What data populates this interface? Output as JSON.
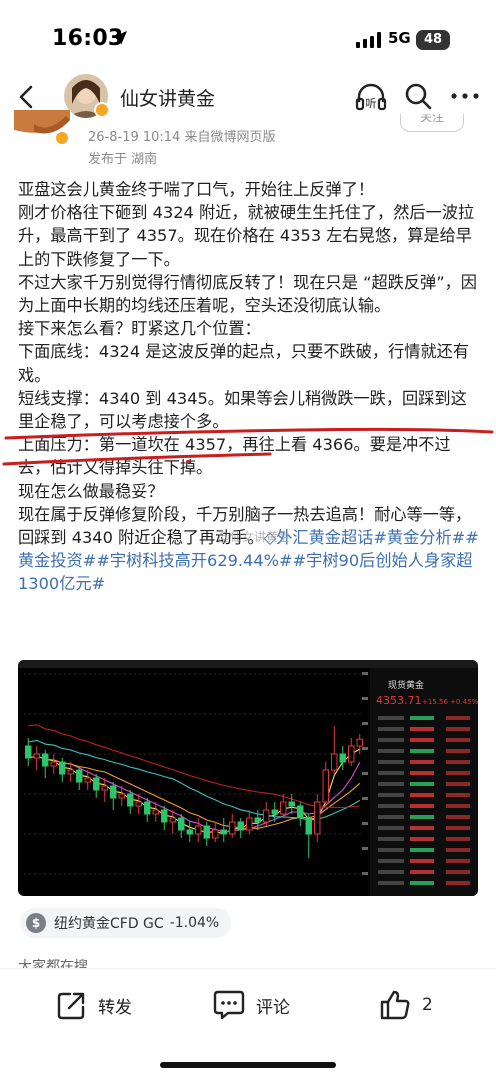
{
  "status_bar": {
    "time": "16:03",
    "network": "5G",
    "battery": "48"
  },
  "header": {
    "title": "仙女讲黄金",
    "back_icon": "chevron-left-icon",
    "listen_icon": "listen-icon",
    "listen_label": "听",
    "search_icon": "search-icon",
    "more_icon": "more-icon"
  },
  "post": {
    "date_source": "26-8-19 10:14  来自微博网页版",
    "location": "发布于 湖南",
    "follow_label": "关注",
    "paragraphs": [
      "亚盘这会儿黄金终于喘了口气，开始往上反弹了！",
      "刚才价格往下砸到 4324 附近，就被硬生生托住了，然后一波拉升，最高干到了 4357。现在价格在 4353 左右晃悠，算是给早上的下跌修复了一下。",
      "不过大家千万别觉得行情彻底反转了！现在只是 “超跌反弹”，因为上面中长期的均线还压着呢，空头还没彻底认输。",
      "接下来怎么看？盯紧这几个位置：",
      "下面底线：4324 是这波反弹的起点，只要不跌破，行情就还有戏。",
      "短线支撑：4340 到 4345。如果等会儿稍微跌一跌，回踩到这里企稳了，可以考虑接个多。",
      "上面压力：第一道坎在 4357，再往上看 4366。要是冲不过去，估计又得掉头往下掉。",
      "现在怎么做最稳妥？",
      "现在属于反弹修复阶段，千万别脑子一热去追高！耐心等一等，回踩到 4340 附近企稳了再动手。"
    ],
    "topics_link": "外汇黄金超话",
    "hashtags": [
      "#黄金分析#",
      "#黄金投资#",
      "#宇树科技高开629.44%#",
      "#宇树90后创始人身家超1300亿元#"
    ],
    "watermark": "@仙女讲黄金"
  },
  "chart_data": {
    "type": "candlestick",
    "title": "",
    "price_axis_range": [
      4320,
      4370
    ],
    "overlay_labels": [
      "现货黄金",
      "4353.71",
      "+15.56",
      "+0.45%"
    ],
    "candles": [
      {
        "o": 4352,
        "c": 4349,
        "h": 4354,
        "l": 4347
      },
      {
        "o": 4349,
        "c": 4350,
        "h": 4352,
        "l": 4346
      },
      {
        "o": 4350,
        "c": 4347,
        "h": 4351,
        "l": 4344
      },
      {
        "o": 4347,
        "c": 4348,
        "h": 4350,
        "l": 4345
      },
      {
        "o": 4348,
        "c": 4345,
        "h": 4349,
        "l": 4343
      },
      {
        "o": 4345,
        "c": 4346,
        "h": 4348,
        "l": 4343
      },
      {
        "o": 4346,
        "c": 4343,
        "h": 4347,
        "l": 4341
      },
      {
        "o": 4343,
        "c": 4344,
        "h": 4346,
        "l": 4341
      },
      {
        "o": 4344,
        "c": 4341,
        "h": 4345,
        "l": 4339
      },
      {
        "o": 4341,
        "c": 4342,
        "h": 4344,
        "l": 4338
      },
      {
        "o": 4342,
        "c": 4339,
        "h": 4343,
        "l": 4336
      },
      {
        "o": 4339,
        "c": 4340,
        "h": 4342,
        "l": 4337
      },
      {
        "o": 4340,
        "c": 4337,
        "h": 4341,
        "l": 4335
      },
      {
        "o": 4337,
        "c": 4338,
        "h": 4340,
        "l": 4335
      },
      {
        "o": 4338,
        "c": 4335,
        "h": 4339,
        "l": 4333
      },
      {
        "o": 4335,
        "c": 4336,
        "h": 4338,
        "l": 4333
      },
      {
        "o": 4336,
        "c": 4333,
        "h": 4337,
        "l": 4331
      },
      {
        "o": 4333,
        "c": 4334,
        "h": 4336,
        "l": 4330
      },
      {
        "o": 4334,
        "c": 4331,
        "h": 4335,
        "l": 4329
      },
      {
        "o": 4331,
        "c": 4330,
        "h": 4333,
        "l": 4328
      },
      {
        "o": 4330,
        "c": 4332,
        "h": 4334,
        "l": 4328
      },
      {
        "o": 4332,
        "c": 4329,
        "h": 4333,
        "l": 4327
      },
      {
        "o": 4329,
        "c": 4331,
        "h": 4333,
        "l": 4328
      },
      {
        "o": 4331,
        "c": 4330,
        "h": 4334,
        "l": 4328
      },
      {
        "o": 4330,
        "c": 4333,
        "h": 4335,
        "l": 4329
      },
      {
        "o": 4333,
        "c": 4331,
        "h": 4334,
        "l": 4329
      },
      {
        "o": 4331,
        "c": 4334,
        "h": 4336,
        "l": 4330
      },
      {
        "o": 4334,
        "c": 4333,
        "h": 4336,
        "l": 4331
      },
      {
        "o": 4333,
        "c": 4336,
        "h": 4338,
        "l": 4332
      },
      {
        "o": 4336,
        "c": 4335,
        "h": 4338,
        "l": 4333
      },
      {
        "o": 4335,
        "c": 4338,
        "h": 4340,
        "l": 4334
      },
      {
        "o": 4338,
        "c": 4337,
        "h": 4340,
        "l": 4335
      },
      {
        "o": 4337,
        "c": 4334,
        "h": 4338,
        "l": 4332
      },
      {
        "o": 4334,
        "c": 4330,
        "h": 4335,
        "l": 4324
      },
      {
        "o": 4330,
        "c": 4338,
        "h": 4340,
        "l": 4328
      },
      {
        "o": 4338,
        "c": 4346,
        "h": 4348,
        "l": 4337
      },
      {
        "o": 4346,
        "c": 4350,
        "h": 4357,
        "l": 4345
      },
      {
        "o": 4350,
        "c": 4348,
        "h": 4352,
        "l": 4346
      },
      {
        "o": 4348,
        "c": 4352,
        "h": 4354,
        "l": 4347
      },
      {
        "o": 4352,
        "c": 4353.71,
        "h": 4355,
        "l": 4350
      }
    ],
    "ma_colors": [
      "#e8e85a",
      "#d050d0",
      "#f0a030",
      "#40c0c0",
      "#c02020"
    ]
  },
  "stock_tag": {
    "icon": "dollar-icon",
    "icon_glyph": "$",
    "name": "纽约黄金CFD GC",
    "change": "-1.04%"
  },
  "others_search": "大家都在搜",
  "actions": {
    "repost": {
      "icon": "repost-icon",
      "label": "转发"
    },
    "comment": {
      "icon": "comment-icon",
      "label": "评论"
    },
    "like": {
      "icon": "like-icon",
      "label": "2"
    }
  }
}
